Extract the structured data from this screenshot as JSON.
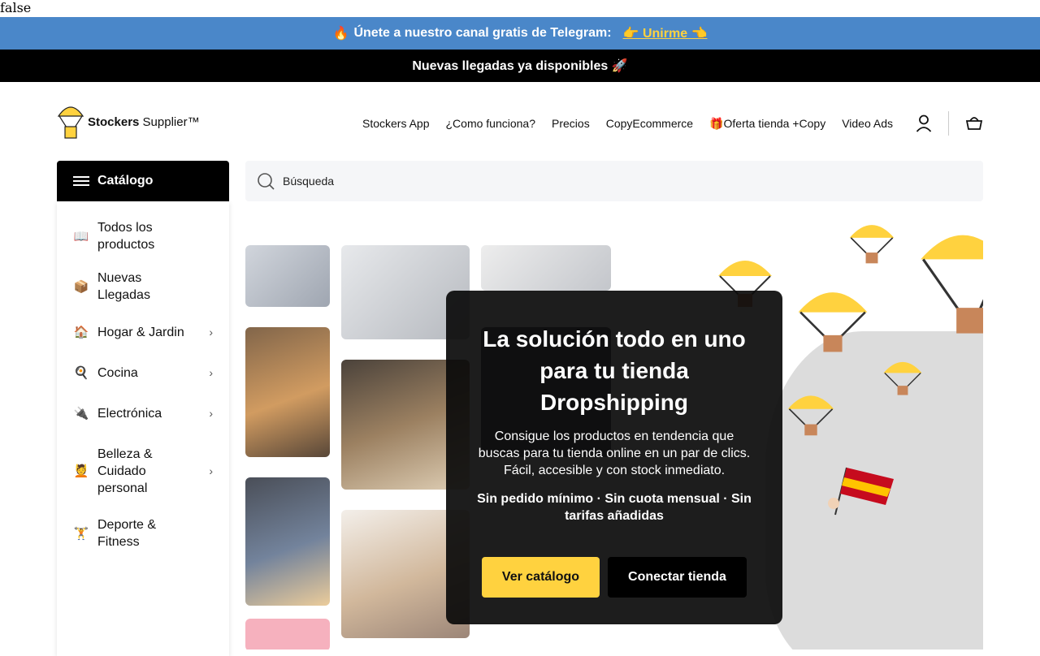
{
  "debug": {
    "text": "false"
  },
  "telegram_bar": {
    "fire_emoji": "🔥",
    "text": "Únete a nuestro canal gratis de Telegram:",
    "join_label": "👉 Unirme 👈"
  },
  "arrivals_bar": {
    "text": "Nuevas llegadas ya disponibles 🚀"
  },
  "logo": {
    "brand_bold": "Stockers",
    "brand_rest": " Supplier™"
  },
  "nav": {
    "items": [
      {
        "label": "Stockers App"
      },
      {
        "label": "¿Como funciona?"
      },
      {
        "label": "Precios"
      },
      {
        "label": "CopyEcommerce"
      },
      {
        "label": "🎁Oferta tienda +Copy"
      },
      {
        "label": "Video Ads"
      }
    ],
    "account_icon": "user-icon",
    "cart_icon": "basket-icon"
  },
  "catalog": {
    "button_label": "Catálogo",
    "items": [
      {
        "label": "Todos los productos",
        "icon": "📖",
        "has_submenu": false
      },
      {
        "label": "Nuevas Llegadas",
        "icon": "📦",
        "has_submenu": false
      },
      {
        "label": "Hogar & Jardin",
        "icon": "🏠",
        "has_submenu": true
      },
      {
        "label": "Cocina",
        "icon": "🍳",
        "has_submenu": true
      },
      {
        "label": "Electrónica",
        "icon": "🔌",
        "has_submenu": true
      },
      {
        "label": "Belleza & Cuidado personal",
        "icon": "💆",
        "has_submenu": true
      },
      {
        "label": "Deporte & Fitness",
        "icon": "🏋",
        "has_submenu": false
      }
    ]
  },
  "search": {
    "placeholder": "Búsqueda"
  },
  "hero": {
    "title": "La solución todo en uno para tu tienda Dropshipping",
    "description": "Consigue los productos en tendencia que buscas para tu tienda online en un par de clics. Fácil, accesible y con stock inmediato.",
    "perks": "Sin pedido mínimo · Sin cuota mensual · Sin tarifas añadidas",
    "primary_button": "Ver catálogo",
    "secondary_button": "Conectar tienda"
  },
  "colors": {
    "telegram_blue": "#4a87c9",
    "accent_yellow": "#ffd23f",
    "black": "#000000"
  }
}
